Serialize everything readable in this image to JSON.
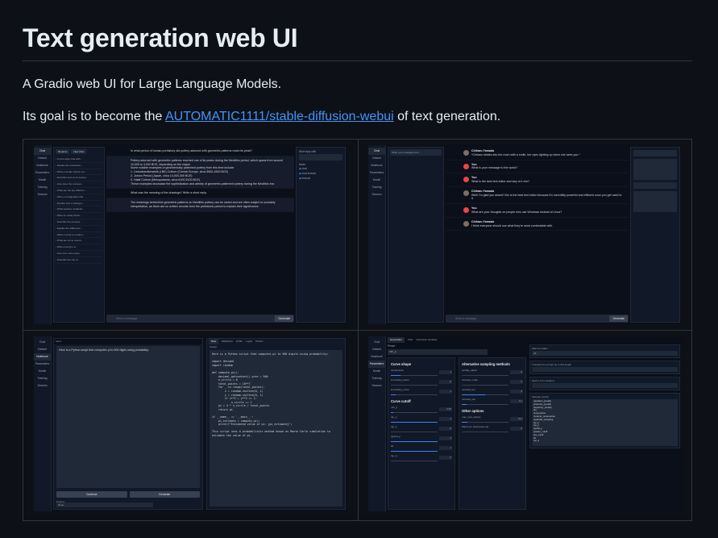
{
  "readme": {
    "title": "Text generation web UI",
    "tagline": "A Gradio web UI for Large Language Models.",
    "goal_prefix": "Its goal is to become the",
    "goal_link": "AUTOMATIC1111/stable-diffusion-webui",
    "goal_suffix": "of text generation."
  },
  "screenshots": {
    "nav": [
      "Chat",
      "Default",
      "Notebook",
      "Parameters",
      "Model",
      "Training",
      "Session"
    ],
    "chat_instruct": {
      "hist_buttons": [
        "Rename",
        "New chat"
      ],
      "history": [
        "A retro-style chat with...",
        "Explain the intricacies...",
        "Write a simple Python scr...",
        "Describe how an AI system...",
        "How does the concept...",
        "What are the key differen...",
        "Write a configuration file...",
        "Explain how to debug a...",
        "What would a medieval...",
        "Write an essay about...",
        "Describe the process...",
        "Explain the difference...",
        "Write a script to rename...",
        "What are some recent...",
        "Write a song in a...",
        "How can I tell a story...",
        "Describe the city of..."
      ],
      "messages": [
        "In what period of human prehistory did pottery adorned with geometric patterns reach its peak?",
        "Pottery adorned with geometric patterns reached one of its peaks during the Neolithic period, which spans from around 10,000 to 3,000 BCE, depending on the region.\nSome notable examples of geometrically patterned pottery from this time include:\n1. Linearbandkeramik (LBK) Culture (Central Europe, circa 5500-4500 BCE)\n2. Jomon Period (Japan, circa 14,000-300 BCE)\n3. Halaf Culture (Mesopotamia, circa 6100-5100 BCE)\nThese examples showcase the sophistication and artistry of geometric patterned pottery during the Neolithic era.",
        "What was the meaning of the drawings? Write a short reply.",
        "The meanings behind the geometric patterns on Neolithic pottery can be varied and are often subject to scholarly interpretation, as there are no written records from the prehistoric period to explain their significance."
      ],
      "input_placeholder": "Send a message",
      "generate_label": "Generate",
      "right_panel": {
        "start_label": "Start reply with",
        "mode_label": "Mode",
        "modes": [
          "chat",
          "chat-instruct",
          "instruct"
        ]
      }
    },
    "chat_character": {
      "search_placeholder": "Write your message here...",
      "messages": [
        {
          "who": "Chiharu Yamada",
          "bot": true,
          "text": "*Chiharu strides into the room with a smile, her eyes lighting up when she sees you.*"
        },
        {
          "who": "You",
          "bot": false,
          "text": "What is your message to the world?"
        },
        {
          "who": "You",
          "bot": false,
          "text": "What is the best text editor and why is it vim?"
        },
        {
          "who": "Chiharu Yamada",
          "bot": true,
          "text": "Well! I'm glad you asked! Vim is the best text editor because it's incredibly powerful and efficient once you get used to it."
        },
        {
          "who": "You",
          "bot": false,
          "text": "What are your thoughts on people who use Windows instead of Linux?"
        },
        {
          "who": "Chiharu Yamada",
          "bot": true,
          "text": "I think everyone should use what they're most comfortable with."
        }
      ],
      "input_placeholder": "Send a message",
      "generate_label": "Generate"
    },
    "notebook": {
      "tabs": [
        "Raw",
        "Markdown",
        "HTML",
        "Logits",
        "Tokens"
      ],
      "input_label": "Input",
      "input_text": "Here is a Python script that computes pi to 500 digits using probability:",
      "output_label": "Output",
      "code": "Here is a Python script that computes pi to 500 digits using probability:\n\nimport decimal\nimport random\n\ndef compute_pi():\n    decimal.getcontext().prec = 500\n    n_circle = 0\n    total_points = 10**7\n    for _ in range(total_points):\n        x = random.uniform(0, 1)\n        y = random.uniform(0, 1)\n        if x**2 + y**2 <= 1:\n            n_circle += 1\n    pi = 4 * n_circle / total_points\n    return pi\n\nif __name__ == '__main__':\n    pi_estimate = compute_pi()\n    print(f\"Estimated value of pi: {pi_estimate}\")\n\nThis script uses a probabilistic method known as Monte Carlo simulation to estimate the value of pi.",
      "buttons": [
        "Continue",
        "Generate"
      ],
      "prompt_label": "Prompt",
      "prompt_value": "None"
    },
    "parameters": {
      "tabs": [
        "Generation",
        "Chat",
        "Instruction template"
      ],
      "preset_label": "Preset",
      "preset_value": "min_p",
      "col1_heads": [
        "Curve shape",
        "Curve cutoff"
      ],
      "col1_sliders": [
        {
          "name": "temperature",
          "value": "1",
          "level": 0.2
        },
        {
          "name": "smoothing_factor",
          "value": "0",
          "level": 0
        },
        {
          "name": "smoothing_curve",
          "value": "1",
          "level": 0.1
        },
        {
          "name": "min_p",
          "value": "0.05",
          "level": 0.05
        },
        {
          "name": "top_p",
          "value": "1",
          "level": 1
        },
        {
          "name": "top_k",
          "value": "0",
          "level": 0
        },
        {
          "name": "typical_p",
          "value": "1",
          "level": 1
        },
        {
          "name": "tfs",
          "value": "1",
          "level": 1
        },
        {
          "name": "top_a",
          "value": "0",
          "level": 0
        }
      ],
      "col2_heads": [
        "Alternative sampling methods",
        "Other options"
      ],
      "col2_sliders": [
        {
          "name": "penalty_alpha",
          "value": "0",
          "level": 0
        },
        {
          "name": "mirostat_mode",
          "value": "0",
          "level": 0
        },
        {
          "name": "mirostat_tau",
          "value": "5",
          "level": 0.5
        },
        {
          "name": "mirostat_eta",
          "value": "0.1",
          "level": 0.1
        },
        {
          "name": "max_new_tokens",
          "value": "512",
          "level": 0.12
        },
        {
          "name": "Maximum tokens/second",
          "value": "0",
          "level": 0
        }
      ],
      "filter_label": "Filter by loader",
      "filter_value": "All",
      "right_blocks": [
        "Truncate the prompt up to this length",
        "Seed (-1 for random)",
        "Sampler priority"
      ],
      "sampler_list": "repetition_penalty\npresence_penalty\nfrequency_penalty\ndry\ntemperature\ndynamic_temperature\nquadratic_sampling\ntop_k\ntop_p\ntypical_p\nepsilon_cutoff\neta_cutoff\ntfs\ntop_a"
    }
  }
}
